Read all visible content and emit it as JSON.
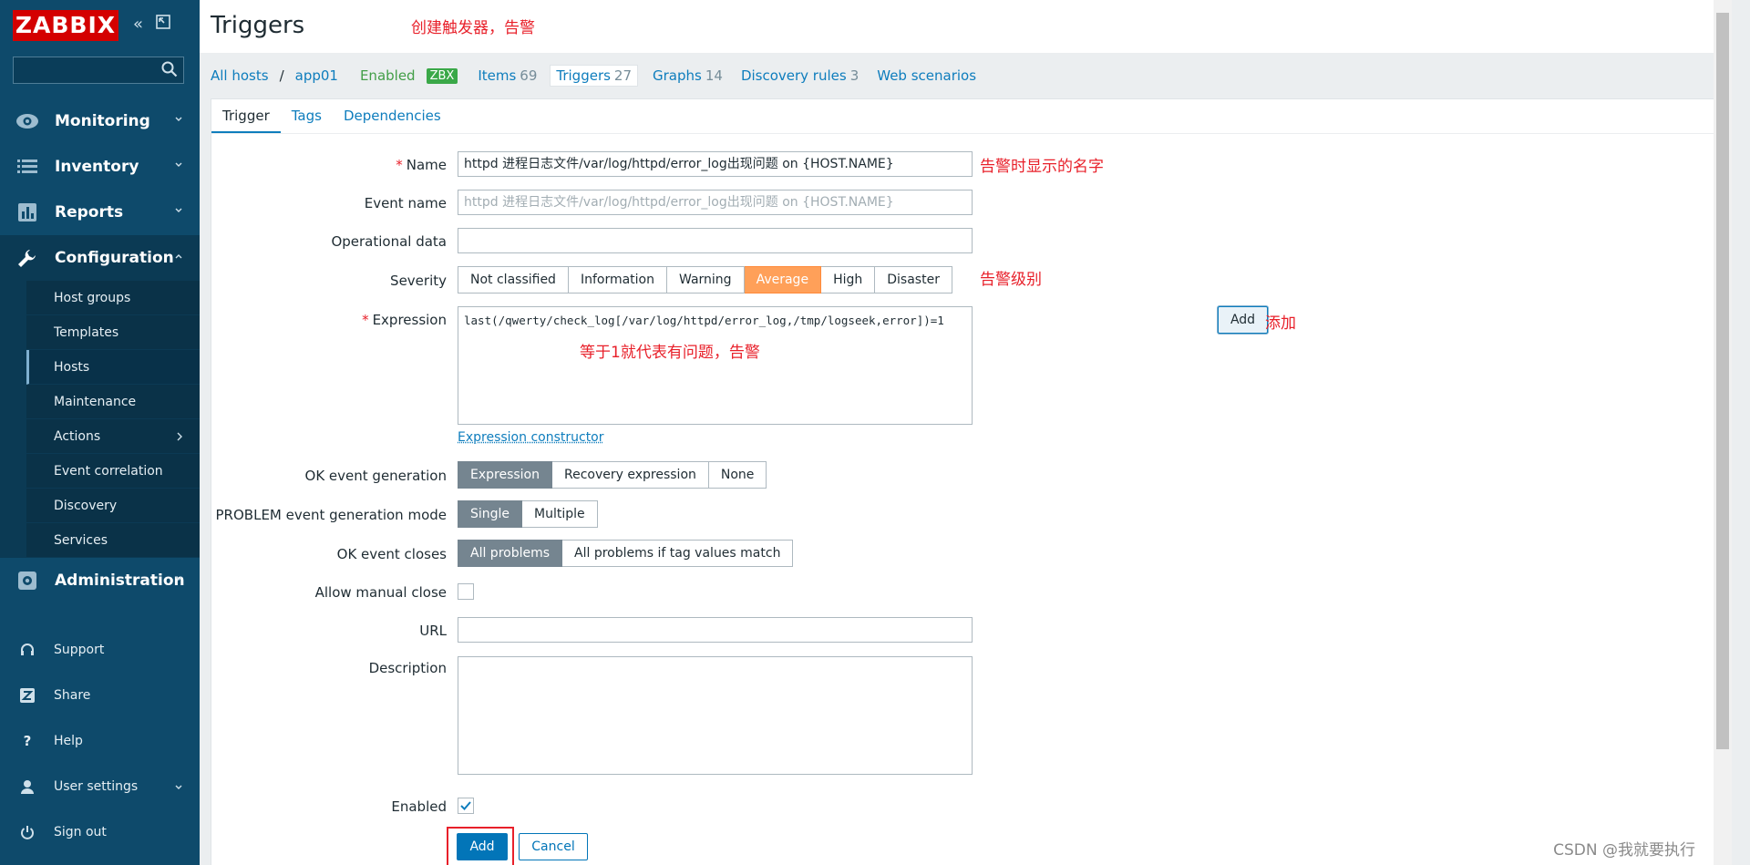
{
  "sidebar": {
    "logo": "ZABBIX",
    "search_placeholder": "",
    "menu": [
      {
        "label": "Monitoring",
        "icon": "eye-icon"
      },
      {
        "label": "Inventory",
        "icon": "list-icon"
      },
      {
        "label": "Reports",
        "icon": "bar-chart-icon"
      },
      {
        "label": "Configuration",
        "icon": "wrench-icon"
      },
      {
        "label": "Administration",
        "icon": "gear-icon"
      }
    ],
    "submenu": [
      {
        "label": "Host groups"
      },
      {
        "label": "Templates"
      },
      {
        "label": "Hosts"
      },
      {
        "label": "Maintenance"
      },
      {
        "label": "Actions"
      },
      {
        "label": "Event correlation"
      },
      {
        "label": "Discovery"
      },
      {
        "label": "Services"
      }
    ],
    "bottom": [
      {
        "label": "Support"
      },
      {
        "label": "Share"
      },
      {
        "label": "Help"
      },
      {
        "label": "User settings"
      },
      {
        "label": "Sign out"
      }
    ]
  },
  "header": {
    "title": "Triggers",
    "annotation": "创建触发器，告警"
  },
  "breadcrumbs": {
    "all_hosts": "All hosts",
    "separator": "/",
    "host": "app01",
    "status": "Enabled",
    "badge": "ZBX",
    "items": "Items",
    "items_count": "69",
    "triggers": "Triggers",
    "triggers_count": "27",
    "graphs": "Graphs",
    "graphs_count": "14",
    "discovery": "Discovery rules",
    "discovery_count": "3",
    "web": "Web scenarios"
  },
  "tabs": [
    "Trigger",
    "Tags",
    "Dependencies"
  ],
  "form": {
    "name_label": "Name",
    "name_value": "httpd 进程日志文件/var/log/httpd/error_log出现问题 on {HOST.NAME}",
    "name_annotation": "告警时显示的名字",
    "event_name_label": "Event name",
    "event_name_placeholder": "httpd 进程日志文件/var/log/httpd/error_log出现问题 on {HOST.NAME}",
    "opdata_label": "Operational data",
    "opdata_value": "",
    "severity_label": "Severity",
    "severity_options": [
      "Not classified",
      "Information",
      "Warning",
      "Average",
      "High",
      "Disaster"
    ],
    "severity_selected": "Average",
    "severity_annotation": "告警级别",
    "expression_label": "Expression",
    "expression_value": "last(/qwerty/check_log[/var/log/httpd/error_log,/tmp/logseek,error])=1",
    "expression_annotation": "等于1就代表有问题，告警",
    "expression_add": "Add",
    "add_annotation": "添加",
    "expression_constructor": "Expression constructor",
    "ok_event_label": "OK event generation",
    "ok_event_options": [
      "Expression",
      "Recovery expression",
      "None"
    ],
    "problem_mode_label": "PROBLEM event generation mode",
    "problem_mode_options": [
      "Single",
      "Multiple"
    ],
    "ok_closes_label": "OK event closes",
    "ok_closes_options": [
      "All problems",
      "All problems if tag values match"
    ],
    "manual_close_label": "Allow manual close",
    "url_label": "URL",
    "url_value": "",
    "description_label": "Description",
    "enabled_label": "Enabled",
    "submit": "Add",
    "cancel": "Cancel"
  },
  "watermark": "CSDN @我就要执行",
  "colors": {
    "sidebar": "#0e4a6b",
    "link": "#0e7dbd",
    "severity_average": "#ffa059",
    "annotation": "#e8202a"
  }
}
